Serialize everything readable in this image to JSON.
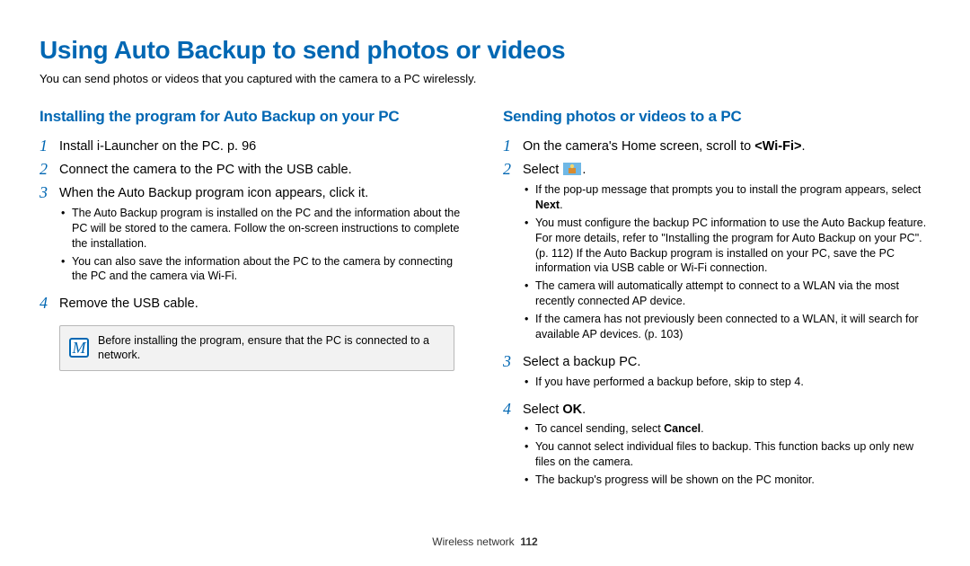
{
  "page": {
    "title": "Using Auto Backup to send photos or videos",
    "intro": "You can send photos or videos that you captured with the camera to a PC wirelessly."
  },
  "left": {
    "heading": "Installing the program for Auto Backup on your PC",
    "steps": [
      {
        "num": "1",
        "text": "Install i-Launcher on the PC. p. 96"
      },
      {
        "num": "2",
        "text": "Connect the camera to the PC with the USB cable."
      },
      {
        "num": "3",
        "text": "When the Auto Backup program icon appears, click it.",
        "sub": [
          "The Auto Backup program is installed on the PC and the information about the PC will be stored to the camera. Follow the on-screen instructions to complete the installation.",
          "You can also save the information about the PC to the camera by connecting the PC and the camera via Wi-Fi."
        ]
      },
      {
        "num": "4",
        "text": "Remove the USB cable."
      }
    ],
    "note": "Before installing the program, ensure that the PC is connected to a network."
  },
  "right": {
    "heading": "Sending photos or videos to a PC",
    "steps": [
      {
        "num": "1",
        "pre": "On the camera's Home screen, scroll to ",
        "bold": "<Wi-Fi>",
        "post": "."
      },
      {
        "num": "2",
        "pre": "Select ",
        "icon": "auto-backup-icon",
        "post": ".",
        "sub_html": [
          {
            "pre": "If the pop-up message that prompts you to install the program appears, select ",
            "bold": "Next",
            "post": "."
          },
          {
            "text": "You must configure the backup PC information to use the Auto Backup feature. For more details, refer to \"Installing the program for Auto Backup on your PC\". (p. 112) If the Auto Backup program is installed on your PC, save the PC information via USB cable or Wi-Fi connection."
          },
          {
            "text": "The camera will automatically attempt to connect to a WLAN via the most recently connected AP device."
          },
          {
            "text": "If the camera has not previously been connected to a WLAN, it will search for available AP devices. (p. 103)"
          }
        ]
      },
      {
        "num": "3",
        "text": "Select a backup PC.",
        "sub": [
          "If you have performed a backup before, skip to step 4."
        ]
      },
      {
        "num": "4",
        "pre": "Select ",
        "bold": "OK",
        "post": ".",
        "sub_html": [
          {
            "pre": "To cancel sending, select ",
            "bold": "Cancel",
            "post": "."
          },
          {
            "text": "You cannot select individual files to backup. This function backs up only new files on the camera."
          },
          {
            "text": "The backup's progress will be shown on the PC monitor."
          }
        ]
      }
    ]
  },
  "footer": {
    "label": "Wireless network",
    "page": "112"
  }
}
